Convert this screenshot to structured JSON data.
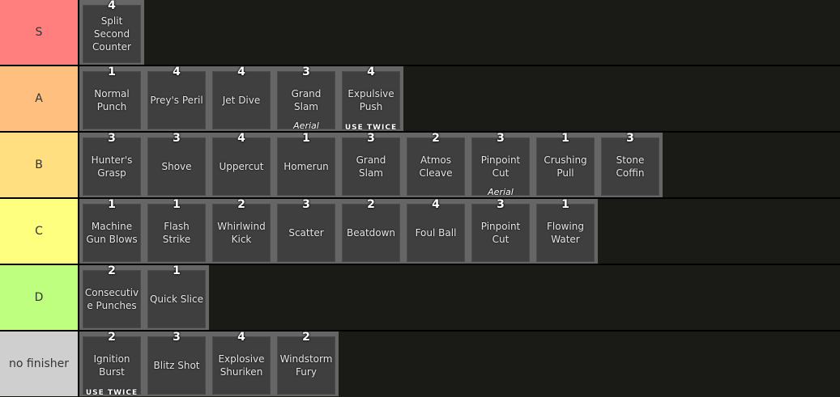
{
  "tiers": [
    {
      "label": "S",
      "color": "#ff7f7f",
      "items": [
        {
          "number": "4",
          "name": "Split Second Counter",
          "sub": ""
        }
      ]
    },
    {
      "label": "A",
      "color": "#ffbf7f",
      "items": [
        {
          "number": "1",
          "name": "Normal Punch",
          "sub": ""
        },
        {
          "number": "4",
          "name": "Prey's Peril",
          "sub": ""
        },
        {
          "number": "4",
          "name": "Jet Dive",
          "sub": ""
        },
        {
          "number": "3",
          "name": "Grand Slam",
          "sub": "Aerial"
        },
        {
          "number": "4",
          "name": "Expulsive Push",
          "sub": "USE TWICE"
        }
      ]
    },
    {
      "label": "B",
      "color": "#ffdf7f",
      "items": [
        {
          "number": "3",
          "name": "Hunter's Grasp",
          "sub": ""
        },
        {
          "number": "3",
          "name": "Shove",
          "sub": ""
        },
        {
          "number": "4",
          "name": "Uppercut",
          "sub": ""
        },
        {
          "number": "1",
          "name": "Homerun",
          "sub": ""
        },
        {
          "number": "3",
          "name": "Grand Slam",
          "sub": ""
        },
        {
          "number": "2",
          "name": "Atmos Cleave",
          "sub": ""
        },
        {
          "number": "3",
          "name": "Pinpoint Cut",
          "sub": "Aerial"
        },
        {
          "number": "1",
          "name": "Crushing Pull",
          "sub": ""
        },
        {
          "number": "3",
          "name": "Stone Coffin",
          "sub": ""
        }
      ]
    },
    {
      "label": "C",
      "color": "#ffff7f",
      "items": [
        {
          "number": "1",
          "name": "Machine Gun Blows",
          "sub": ""
        },
        {
          "number": "1",
          "name": "Flash Strike",
          "sub": ""
        },
        {
          "number": "2",
          "name": "Whirlwind Kick",
          "sub": ""
        },
        {
          "number": "3",
          "name": "Scatter",
          "sub": ""
        },
        {
          "number": "2",
          "name": "Beatdown",
          "sub": ""
        },
        {
          "number": "4",
          "name": "Foul Ball",
          "sub": ""
        },
        {
          "number": "3",
          "name": "Pinpoint Cut",
          "sub": ""
        },
        {
          "number": "1",
          "name": "Flowing Water",
          "sub": ""
        }
      ]
    },
    {
      "label": "D",
      "color": "#bfff7f",
      "items": [
        {
          "number": "2",
          "name": "Consecutive Punches",
          "sub": ""
        },
        {
          "number": "1",
          "name": "Quick Slice",
          "sub": ""
        }
      ]
    },
    {
      "label": "no finisher",
      "color": "#cfcfcf",
      "items": [
        {
          "number": "2",
          "name": "Ignition Burst",
          "sub": "USE TWICE"
        },
        {
          "number": "3",
          "name": "Blitz Shot",
          "sub": ""
        },
        {
          "number": "4",
          "name": "Explosive Shuriken",
          "sub": ""
        },
        {
          "number": "2",
          "name": "Windstorm Fury",
          "sub": ""
        }
      ]
    }
  ]
}
